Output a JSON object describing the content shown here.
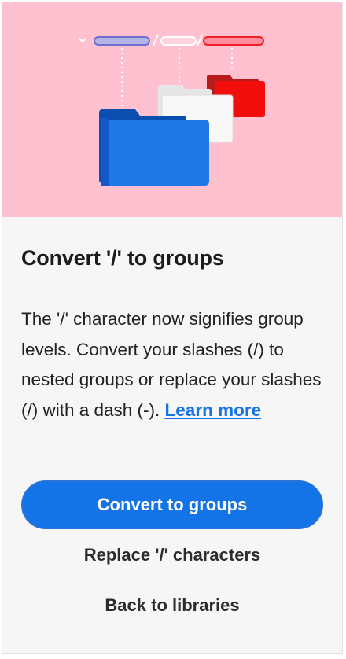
{
  "hero": {
    "illustration": "nested-folders-illustration"
  },
  "title": "Convert '/' to groups",
  "body": {
    "text": "The '/' character now signifies group levels. Convert your slashes (/) to nested groups or replace your slashes (/) with a dash (-). ",
    "link_label": "Learn more"
  },
  "actions": {
    "convert_label": "Convert to groups",
    "replace_label": "Replace '/' characters",
    "back_label": "Back to libraries"
  },
  "colors": {
    "hero_bg": "#ffc0cf",
    "accent_blue": "#1473e6",
    "folder_red": "#f30e0e",
    "text": "#1c1c1c"
  }
}
